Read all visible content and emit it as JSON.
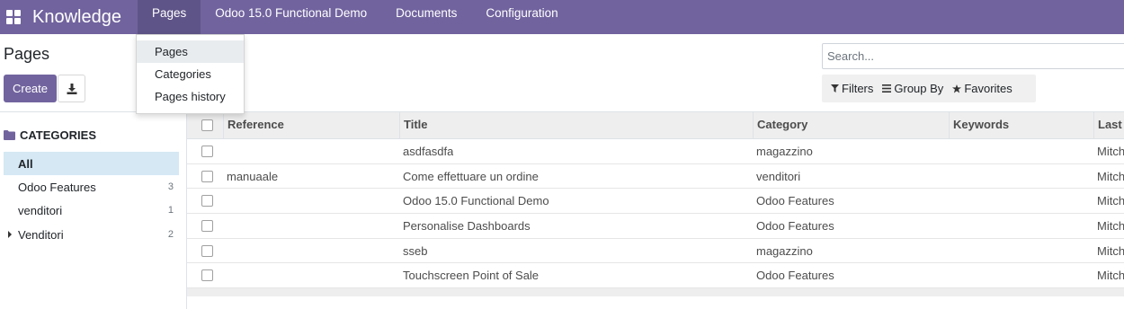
{
  "navbar": {
    "brand": "Knowledge",
    "menus": [
      "Pages",
      "Odoo 15.0 Functional Demo",
      "Documents",
      "Configuration"
    ]
  },
  "dropdown": {
    "items": [
      "Pages",
      "Categories",
      "Pages history"
    ]
  },
  "control_panel": {
    "title": "Pages",
    "create_label": "Create",
    "search_placeholder": "Search...",
    "filters_label": "Filters",
    "groupby_label": "Group By",
    "favorites_label": "Favorites"
  },
  "sidebar": {
    "header": "CATEGORIES",
    "items": [
      {
        "label": "All",
        "count": ""
      },
      {
        "label": "Odoo Features",
        "count": "3"
      },
      {
        "label": "venditori",
        "count": "1"
      },
      {
        "label": "Venditori",
        "count": "2"
      }
    ]
  },
  "table": {
    "columns": [
      "Reference",
      "Title",
      "Category",
      "Keywords",
      "Last"
    ],
    "rows": [
      {
        "reference": "",
        "title": "asdfasdfa",
        "category": "magazzino",
        "keywords": "",
        "last": "Mitch"
      },
      {
        "reference": "manuaale",
        "title": "Come effettuare un ordine",
        "category": "venditori",
        "keywords": "",
        "last": "Mitch"
      },
      {
        "reference": "",
        "title": "Odoo 15.0 Functional Demo",
        "category": "Odoo Features",
        "keywords": "",
        "last": "Mitch"
      },
      {
        "reference": "",
        "title": "Personalise Dashboards",
        "category": "Odoo Features",
        "keywords": "",
        "last": "Mitch"
      },
      {
        "reference": "",
        "title": "sseb",
        "category": "magazzino",
        "keywords": "",
        "last": "Mitch"
      },
      {
        "reference": "",
        "title": "Touchscreen Point of Sale",
        "category": "Odoo Features",
        "keywords": "",
        "last": "Mitch"
      }
    ]
  },
  "colors": {
    "brand": "#71639e",
    "active_category": "#d5e8f4"
  }
}
